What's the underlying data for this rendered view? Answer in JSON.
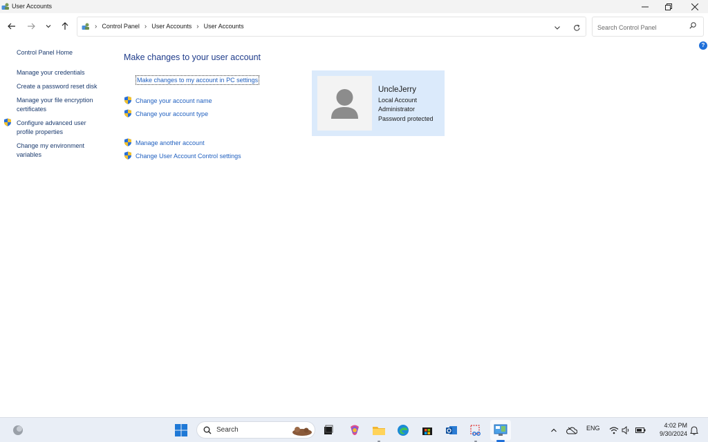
{
  "window": {
    "title": "User Accounts",
    "controls": [
      "minimize-icon",
      "restore-icon",
      "close-icon"
    ]
  },
  "address": {
    "crumbs": [
      "Control Panel",
      "User Accounts",
      "User Accounts"
    ],
    "search_placeholder": "Search Control Panel"
  },
  "leftnav": {
    "home": "Control Panel Home",
    "items": [
      {
        "label": "Manage your credentials"
      },
      {
        "label": "Create a password reset disk"
      },
      {
        "label": "Manage your file encryption certificates"
      },
      {
        "label": "Configure advanced user profile properties"
      },
      {
        "label": "Change my environment variables"
      }
    ]
  },
  "main": {
    "heading": "Make changes to your user account",
    "pc_settings_link": "Make changes to my account in PC settings",
    "tasks": [
      {
        "label": "Change your account name"
      },
      {
        "label": "Change your account type"
      },
      {
        "label": "Manage another account"
      },
      {
        "label": "Change User Account Control settings"
      }
    ]
  },
  "user": {
    "name": "UncleJerry",
    "lines": [
      "Local Account",
      "Administrator",
      "Password protected"
    ]
  },
  "taskbar": {
    "search_label": "Search",
    "tray": {
      "language": "ENG"
    },
    "clock": {
      "time": "4:02 PM",
      "date": "9/30/2024"
    }
  },
  "colors": {
    "link": "#1f5fbf",
    "heading": "#1e3b8a",
    "tile_bg": "#dbeafb",
    "accent": "#1e6fd9"
  }
}
